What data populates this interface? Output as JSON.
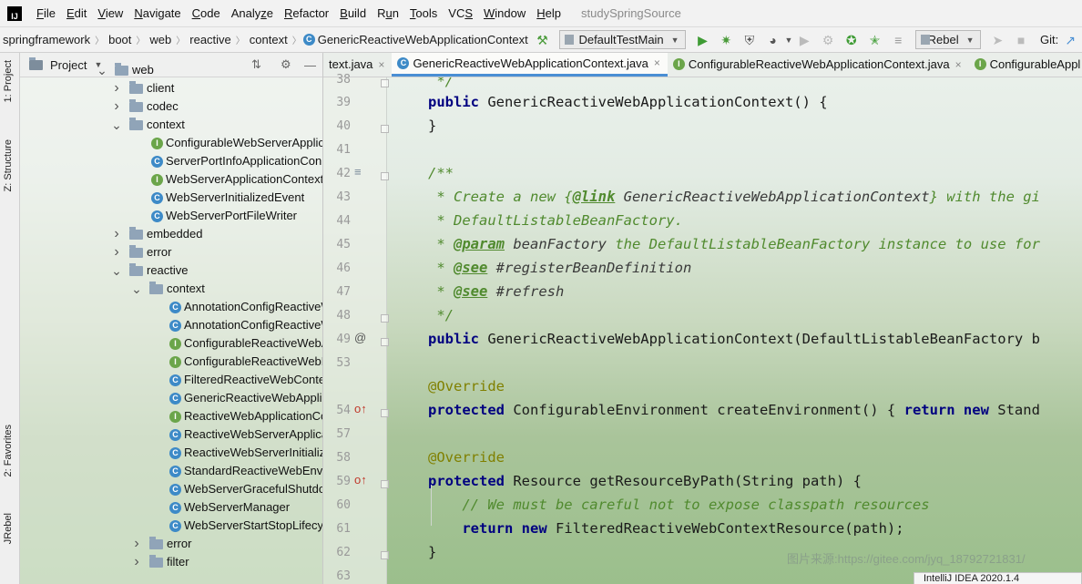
{
  "menu": {
    "items": [
      "File",
      "Edit",
      "View",
      "Navigate",
      "Code",
      "Analyze",
      "Refactor",
      "Build",
      "Run",
      "Tools",
      "VCS",
      "Window",
      "Help"
    ],
    "mnemonics": [
      "F",
      "E",
      "V",
      "N",
      "C",
      "z",
      "R",
      "B",
      "u",
      "T",
      "S",
      "W",
      "H"
    ],
    "project_name": "studySpringSource"
  },
  "nav": {
    "crumbs": [
      "springframework",
      "boot",
      "web",
      "reactive",
      "context",
      "GenericReactiveWebApplicationContext"
    ],
    "run_config": "DefaultTestMain",
    "jrebel": "JRebel",
    "git": "Git:"
  },
  "left_strip": {
    "tabs": [
      "1: Project",
      "Z: Structure",
      "2: Favorites",
      "JRebel"
    ]
  },
  "project": {
    "title": "Project",
    "rows": [
      {
        "label": "web",
        "kind": "folder",
        "depth": 0,
        "arrow": "v"
      },
      {
        "label": "client",
        "kind": "folder",
        "depth": 1,
        "arrow": ">"
      },
      {
        "label": "codec",
        "kind": "folder",
        "depth": 1,
        "arrow": ">"
      },
      {
        "label": "context",
        "kind": "folder",
        "depth": 1,
        "arrow": "v"
      },
      {
        "label": "ConfigurableWebServerApplic",
        "kind": "interface",
        "depth": 2
      },
      {
        "label": "ServerPortInfoApplicationCon",
        "kind": "class",
        "depth": 2
      },
      {
        "label": "WebServerApplicationContext",
        "kind": "interface",
        "depth": 2
      },
      {
        "label": "WebServerInitializedEvent",
        "kind": "class",
        "depth": 2
      },
      {
        "label": "WebServerPortFileWriter",
        "kind": "class",
        "depth": 2
      },
      {
        "label": "embedded",
        "kind": "folder",
        "depth": 1,
        "arrow": ">"
      },
      {
        "label": "error",
        "kind": "folder",
        "depth": 1,
        "arrow": ">"
      },
      {
        "label": "reactive",
        "kind": "folder",
        "depth": 1,
        "arrow": "v"
      },
      {
        "label": "context",
        "kind": "folder",
        "depth": 2,
        "arrow": "v"
      },
      {
        "label": "AnnotationConfigReactiveW",
        "kind": "class",
        "depth": 3
      },
      {
        "label": "AnnotationConfigReactiveW",
        "kind": "class",
        "depth": 3
      },
      {
        "label": "ConfigurableReactiveWebA",
        "kind": "interface",
        "depth": 3
      },
      {
        "label": "ConfigurableReactiveWebE",
        "kind": "interface",
        "depth": 3
      },
      {
        "label": "FilteredReactiveWebConte",
        "kind": "class",
        "depth": 3
      },
      {
        "label": "GenericReactiveWebApplic",
        "kind": "class",
        "depth": 3
      },
      {
        "label": "ReactiveWebApplicationCo",
        "kind": "interface",
        "depth": 3
      },
      {
        "label": "ReactiveWebServerApplica",
        "kind": "class",
        "depth": 3
      },
      {
        "label": "ReactiveWebServerInitializ",
        "kind": "class",
        "depth": 3
      },
      {
        "label": "StandardReactiveWebEnvi",
        "kind": "class",
        "depth": 3
      },
      {
        "label": "WebServerGracefulShutdo",
        "kind": "class",
        "depth": 3
      },
      {
        "label": "WebServerManager",
        "kind": "class",
        "depth": 3
      },
      {
        "label": "WebServerStartStopLifecyc",
        "kind": "class",
        "depth": 3
      },
      {
        "label": "error",
        "kind": "folder",
        "depth": 2,
        "arrow": ">"
      },
      {
        "label": "filter",
        "kind": "folder",
        "depth": 2,
        "arrow": ">"
      }
    ]
  },
  "editor": {
    "tabs": [
      {
        "label": "text.java",
        "kind": "none"
      },
      {
        "label": "GenericReactiveWebApplicationContext.java",
        "kind": "class",
        "active": true
      },
      {
        "label": "ConfigurableReactiveWebApplicationContext.java",
        "kind": "interface"
      },
      {
        "label": "ConfigurableAppl",
        "kind": "interface"
      }
    ],
    "line_numbers": [
      "38",
      "39",
      "40",
      "41",
      "42",
      "43",
      "44",
      "45",
      "46",
      "47",
      "48",
      "49",
      "53",
      "54",
      "57",
      "58",
      "59",
      "60",
      "61",
      "62",
      "63"
    ],
    "watermark": "图片来源:https://gitee.com/jyq_18792721831/",
    "popup": "IntelliJ IDEA 2020.1.4"
  }
}
